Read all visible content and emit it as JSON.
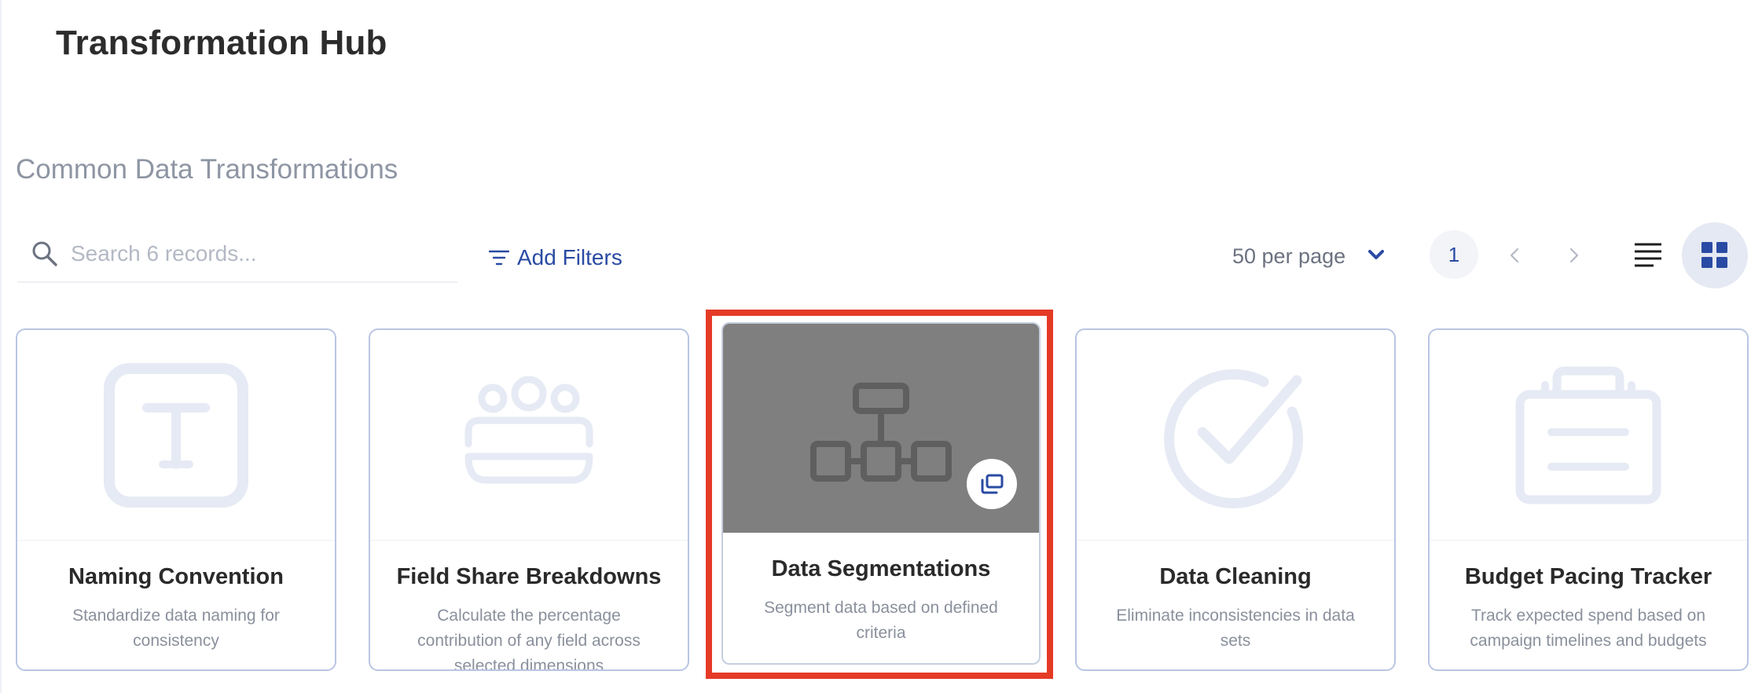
{
  "header": {
    "title": "Transformation Hub"
  },
  "section": {
    "title": "Common Data Transformations"
  },
  "toolbar": {
    "search_placeholder": "Search 6 records...",
    "add_filters_label": "Add Filters",
    "per_page_label": "50 per page",
    "current_page": "1"
  },
  "colors": {
    "accent": "#2a4ba3",
    "card_border": "#b9c6e3",
    "icon_light": "#e6eaf4",
    "highlight": "#e53a26"
  },
  "cards": [
    {
      "title": "Naming Convention",
      "description": "Standardize data naming for consistency",
      "icon": "text-format-icon"
    },
    {
      "title": "Field Share Breakdowns",
      "description": "Calculate the percentage contribution of any field across selected dimensions",
      "icon": "users-group-icon"
    },
    {
      "title": "Data Segmentations",
      "description": "Segment data based on defined criteria",
      "icon": "hierarchy-icon"
    },
    {
      "title": "Data Cleaning",
      "description": "Eliminate inconsistencies in data sets",
      "icon": "check-circle-icon"
    },
    {
      "title": "Budget Pacing Tracker",
      "description": "Track expected spend based on campaign timelines and budgets",
      "icon": "briefcase-icon"
    }
  ]
}
